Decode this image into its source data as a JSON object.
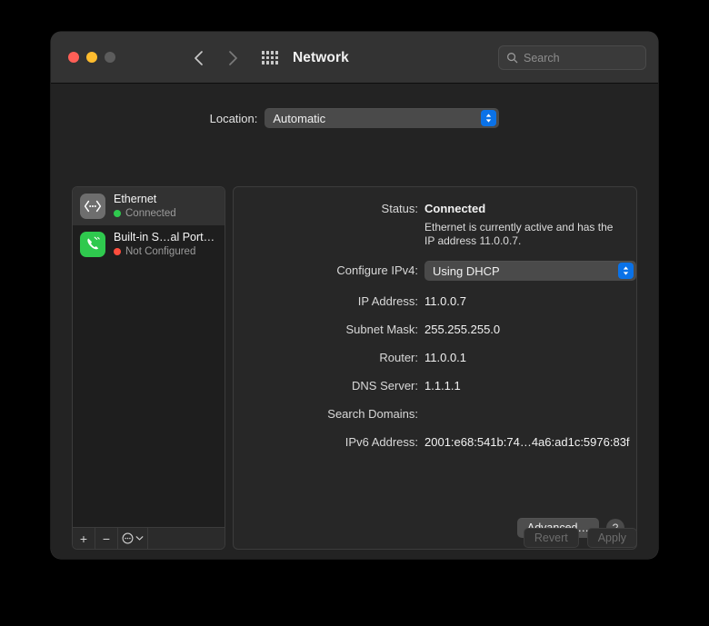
{
  "window": {
    "title": "Network",
    "traffic_lights": [
      "close-red",
      "minimize-yellow",
      "zoom-gray"
    ],
    "nav": {
      "back": "back-chevron",
      "forward": "forward-chevron",
      "grid": "show-all-grid"
    },
    "search": {
      "value": "",
      "placeholder": "Search",
      "icon": "search-icon"
    }
  },
  "location": {
    "label": "Location:",
    "value": "Automatic",
    "options": [
      "Automatic"
    ]
  },
  "sidebar": {
    "services": [
      {
        "name": "Ethernet",
        "status": "Connected",
        "status_color": "#2fc94e",
        "icon": "ethernet-icon",
        "selected": true
      },
      {
        "name": "Built-in S…al Port (1)",
        "status": "Not Configured",
        "status_color": "#ff4d3d",
        "icon": "serial-port-phone-icon",
        "selected": false
      }
    ],
    "toolbar": {
      "add": "+",
      "remove": "−",
      "action": "⋯",
      "action_chevron": "chevron-down-icon"
    }
  },
  "detail": {
    "status_label": "Status:",
    "status_value": "Connected",
    "status_description": "Ethernet is currently active and has the IP address 11.0.0.7.",
    "configure_label": "Configure IPv4:",
    "configure_value": "Using DHCP",
    "configure_options": [
      "Using DHCP"
    ],
    "fields": [
      {
        "label": "IP Address:",
        "value": "11.0.0.7"
      },
      {
        "label": "Subnet Mask:",
        "value": "255.255.255.0"
      },
      {
        "label": "Router:",
        "value": "11.0.0.1"
      },
      {
        "label": "DNS Server:",
        "value": "1.1.1.1"
      },
      {
        "label": "Search Domains:",
        "value": ""
      },
      {
        "label": "IPv6 Address:",
        "value": "2001:e68:541b:74…4a6:ad1c:5976:83f"
      }
    ],
    "advanced_label": "Advanced…",
    "help_label": "?"
  },
  "footer": {
    "revert_label": "Revert",
    "apply_label": "Apply"
  },
  "colors": {
    "accent": "#0a72e8",
    "connected": "#2fc94e",
    "not_configured": "#ff4d3d",
    "window_bg": "#232323",
    "titlebar_bg": "#333333"
  }
}
